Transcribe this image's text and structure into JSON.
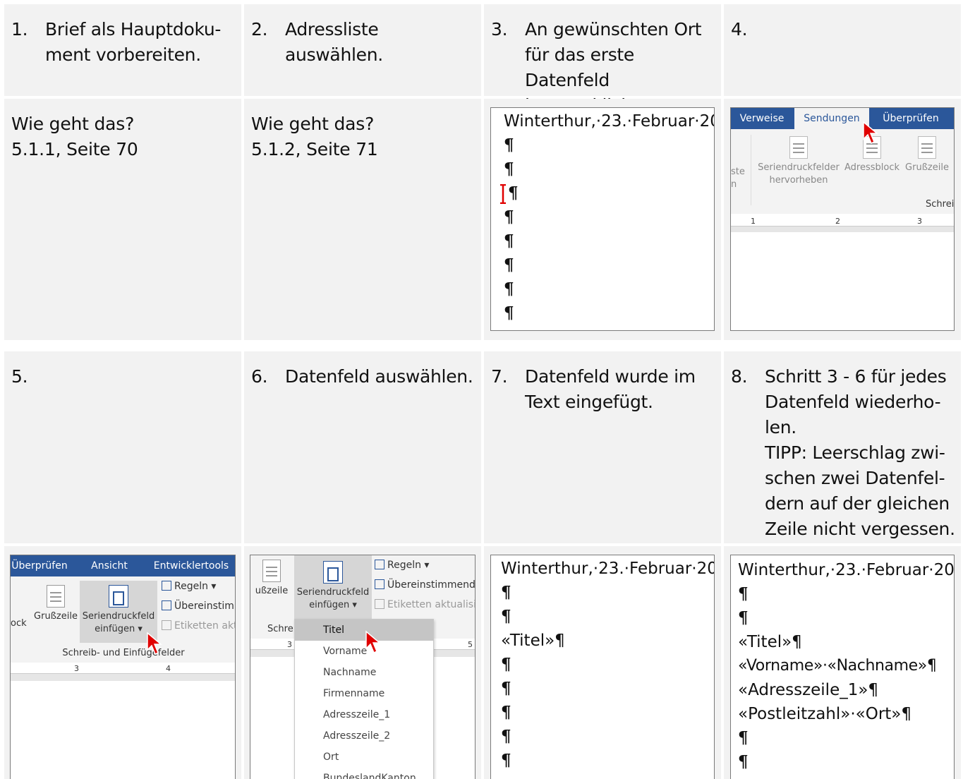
{
  "steps": [
    {
      "num": "1.",
      "text": "Brief als Hauptdoku-\nment vorbereiten."
    },
    {
      "num": "2.",
      "text": "Adressliste auswählen."
    },
    {
      "num": "3.",
      "text": "An gewünschten Ort\nfür das erste Datenfeld\nim Text klicken."
    },
    {
      "num": "4.",
      "text": ""
    },
    {
      "num": "5.",
      "text": ""
    },
    {
      "num": "6.",
      "text": "Datenfeld auswählen."
    },
    {
      "num": "7.",
      "text": "Datenfeld wurde im\nText eingefügt."
    },
    {
      "num": "8.",
      "text": "Schritt 3 - 6 für jedes\nDatenfeld wiederho-\nlen.\nTIPP: Leerschlag zwi-\nschen zwei Datenfel-\ndern auf der gleichen\nZeile nicht vergessen."
    }
  ],
  "info": [
    {
      "line1": "Wie geht das?",
      "line2": "5.1.1, Seite 70"
    },
    {
      "line1": "Wie geht das?",
      "line2": "5.1.2, Seite 71"
    }
  ],
  "doc_header": "Winterthur,·23.·Februar·20",
  "pilcrow": "¶",
  "shot4": {
    "tabs": [
      "Verweise",
      "Sendungen",
      "Überprüfen"
    ],
    "buttons": [
      "ste\nn",
      "Seriendruckfelder\nhervorheben",
      "Adressblock",
      "Grußzeile"
    ],
    "group": "Schrei",
    "ruler": [
      "1",
      "2",
      "3"
    ]
  },
  "shot5": {
    "tabs": [
      "Überprüfen",
      "Ansicht",
      "Entwicklertools"
    ],
    "left_label": "ock",
    "gruss": "Grußzeile",
    "insert_btn": "Seriendruckfeld\neinfügen ▾",
    "rules": "Regeln ▾",
    "match": "Übereinstim",
    "labels": "Etiketten akt",
    "group": "Schreib- und Einfügefelder",
    "ruler": [
      "3",
      "4"
    ]
  },
  "shot6": {
    "gruss": "ußzeile",
    "insert_btn": "Seriendruckfeld\neinfügen ▾",
    "rules": "Regeln ▾",
    "match": "Übereinstimmend",
    "labels": "Etiketten aktualisi",
    "group": "Schre",
    "ruler": [
      "3",
      "5"
    ],
    "menu": [
      "Titel",
      "Vorname",
      "Nachname",
      "Firmenname",
      "Adresszeile_1",
      "Adresszeile_2",
      "Ort",
      "BundeslandKanton"
    ]
  },
  "shot7": {
    "lines": [
      "¶",
      "¶",
      "«Titel»¶",
      "¶",
      "¶",
      "¶",
      "¶",
      "¶"
    ]
  },
  "shot8": {
    "lines": [
      "¶",
      "¶",
      "«Titel»¶",
      "«Vorname»·«Nachname»¶",
      "«Adresszeile_1»¶",
      "«Postleitzahl»·«Ort»¶",
      "¶",
      "¶"
    ]
  },
  "colors": {
    "accent": "#2b579a",
    "cell_bg": "#f2f2f2",
    "cursor": "#e00000"
  }
}
